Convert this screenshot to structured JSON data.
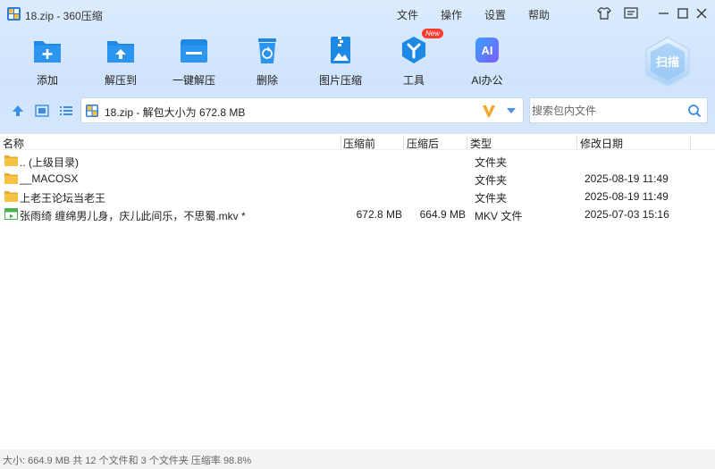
{
  "window": {
    "title": "18.zip - 360压缩"
  },
  "menu": [
    "文件",
    "操作",
    "设置",
    "帮助"
  ],
  "toolbar": {
    "items": [
      {
        "label": "添加",
        "icon": "add-icon"
      },
      {
        "label": "解压到",
        "icon": "extract-to-icon"
      },
      {
        "label": "一键解压",
        "icon": "one-click-extract-icon"
      },
      {
        "label": "删除",
        "icon": "delete-icon"
      },
      {
        "label": "图片压缩",
        "icon": "image-compress-icon"
      },
      {
        "label": "工具",
        "icon": "tools-icon",
        "badge": "New"
      },
      {
        "label": "AI办公",
        "icon": "ai-office-icon",
        "icon_text": "AI"
      }
    ],
    "scan_label": "扫描"
  },
  "address": {
    "path": "18.zip - 解包大小为 672.8 MB"
  },
  "search": {
    "placeholder": "搜索包内文件"
  },
  "columns": {
    "name": "名称",
    "compressed_before": "压缩前",
    "compressed_after": "压缩后",
    "type": "类型",
    "modified": "修改日期"
  },
  "files": [
    {
      "name": ".. (上级目录)",
      "before": "",
      "after": "",
      "type": "文件夹",
      "modified": "",
      "kind": "folder"
    },
    {
      "name": "__MACOSX",
      "before": "",
      "after": "",
      "type": "文件夹",
      "modified": "2025-08-19 11:49",
      "kind": "folder"
    },
    {
      "name": "上老王论坛当老王",
      "before": "",
      "after": "",
      "type": "文件夹",
      "modified": "2025-08-19 11:49",
      "kind": "folder"
    },
    {
      "name": "张雨绮 缠绵男儿身，庆儿此间乐，不思蜀.mkv *",
      "before": "672.8 MB",
      "after": "664.9 MB",
      "type": "MKV 文件",
      "modified": "2025-07-03 15:16",
      "kind": "video"
    }
  ],
  "status": "大小: 664.9 MB 共 12 个文件和 3 个文件夹 压缩率 98.8%",
  "colors": {
    "accent": "#1e88e5",
    "toolbar_bg": "#d4e6fc",
    "folder": "#f5c242"
  }
}
